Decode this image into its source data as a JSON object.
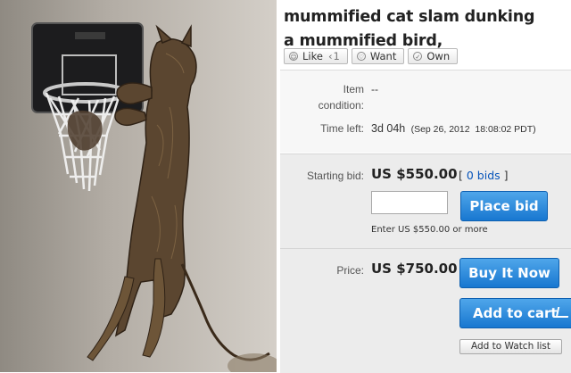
{
  "listing": {
    "title_line1": "mummified cat slam dunking",
    "title_line2": "a mummified bird,"
  },
  "social": {
    "like_label": "Like",
    "like_count": "1",
    "want_label": "Want",
    "own_label": "Own"
  },
  "details": {
    "condition_label_1": "Item",
    "condition_label_2": "condition:",
    "condition_value": "--",
    "time_left_label": "Time left:",
    "time_left_value": "3d 04h",
    "end_date": "(Sep 26, 2012  18:08:02 PDT)"
  },
  "bid": {
    "starting_bid_label": "Starting bid:",
    "starting_bid_value": "US $550.00",
    "bids_open": "[ ",
    "bids_link": "0 bids",
    "bids_close": " ]",
    "bid_input_value": "",
    "place_bid_label": "Place bid",
    "hint": "Enter US $550.00 or more"
  },
  "buy": {
    "price_label": "Price:",
    "price_value": "US $750.00",
    "buy_now_label": "Buy It Now",
    "add_to_cart_label": "Add to cart",
    "watch_label": "Add to Watch list"
  },
  "icons": {
    "like": "smiley-icon",
    "want": "heart-icon",
    "own": "checkmark-icon",
    "cart": "cart-icon"
  }
}
